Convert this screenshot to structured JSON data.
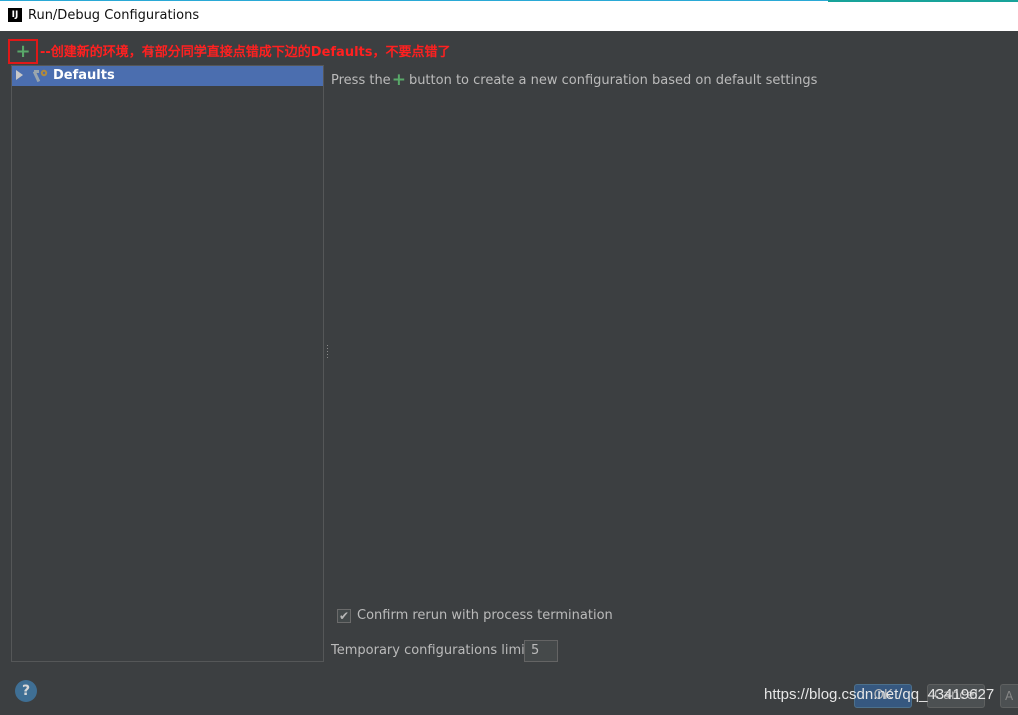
{
  "window": {
    "title": "Run/Debug Configurations",
    "app_icon": "IJ"
  },
  "toolbar": {
    "add_icon": "+",
    "annotation": "--创建新的环境，有部分同学直接点错成下边的Defaults，不要点错了"
  },
  "tree": {
    "items": [
      {
        "label": "Defaults",
        "icon": "wrench-gear-icon",
        "expanded": false,
        "selected": true
      }
    ]
  },
  "main": {
    "hint_before": "Press the",
    "hint_after": "button to create a new configuration based on default settings",
    "confirm_rerun_label": "Confirm rerun with process termination",
    "confirm_rerun_checked": true,
    "temp_limit_label": "Temporary configurations limit:",
    "temp_limit_value": "5"
  },
  "footer": {
    "help_label": "?",
    "ok_label": "OK",
    "cancel_label": "Cancel",
    "apply_label": "A"
  },
  "watermark": "https://blog.csdn.net/qq_43419627",
  "colors": {
    "background": "#3c3f41",
    "selection": "#4b6eaf",
    "add_green": "#59a869",
    "annotation_red": "#ff2020"
  }
}
